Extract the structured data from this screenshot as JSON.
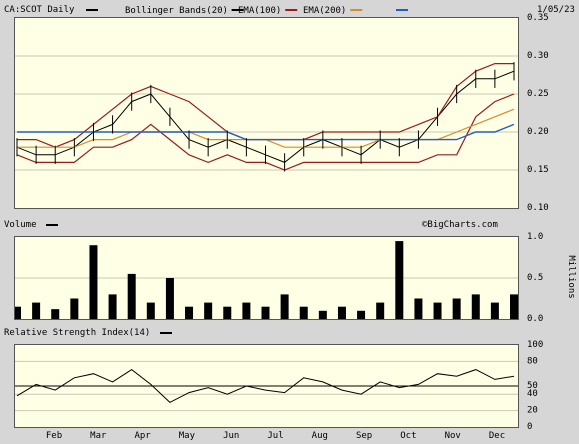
{
  "header": {
    "symbol": "CA:SCOT Daily",
    "legend": [
      {
        "name": "Bollinger Bands(20)",
        "color": "#000000"
      },
      {
        "name": "EMA(100)",
        "color": "#9a1c1c"
      },
      {
        "name": "EMA(200)",
        "color": "#d98b2b"
      }
    ],
    "date": "1/05/23",
    "ema200_line_color": "#1f5fc4"
  },
  "volume_header": "Volume",
  "rsi_header": "Relative Strength Index(14)",
  "watermark": "©BigCharts.com",
  "months": [
    "Feb",
    "Mar",
    "Apr",
    "May",
    "Jun",
    "Jul",
    "Aug",
    "Sep",
    "Oct",
    "Nov",
    "Dec"
  ],
  "volume_axis_title": "Millions",
  "chart_data": [
    {
      "type": "line",
      "panel": "price",
      "ylim": [
        0.1,
        0.35
      ],
      "yticks": [
        "0.35",
        "0.30",
        "0.25",
        "0.20",
        "0.15",
        "0.10"
      ],
      "x": [
        "2022-01-10",
        "2022-01-24",
        "2022-02-07",
        "2022-02-21",
        "2022-03-07",
        "2022-03-21",
        "2022-04-04",
        "2022-04-18",
        "2022-05-02",
        "2022-05-16",
        "2022-05-30",
        "2022-06-13",
        "2022-06-27",
        "2022-07-11",
        "2022-07-25",
        "2022-08-08",
        "2022-08-22",
        "2022-09-05",
        "2022-09-19",
        "2022-10-03",
        "2022-10-17",
        "2022-10-31",
        "2022-11-14",
        "2022-11-28",
        "2022-12-12",
        "2022-12-26",
        "2023-01-05"
      ],
      "series": [
        {
          "name": "Price",
          "values": [
            0.18,
            0.17,
            0.17,
            0.18,
            0.2,
            0.21,
            0.24,
            0.25,
            0.22,
            0.19,
            0.18,
            0.19,
            0.18,
            0.17,
            0.16,
            0.18,
            0.19,
            0.18,
            0.17,
            0.19,
            0.18,
            0.19,
            0.22,
            0.25,
            0.27,
            0.27,
            0.28
          ]
        },
        {
          "name": "Bollinger upper",
          "values": [
            0.19,
            0.19,
            0.18,
            0.19,
            0.21,
            0.23,
            0.25,
            0.26,
            0.25,
            0.24,
            0.22,
            0.2,
            0.19,
            0.19,
            0.19,
            0.19,
            0.2,
            0.2,
            0.2,
            0.2,
            0.2,
            0.21,
            0.22,
            0.26,
            0.28,
            0.29,
            0.29
          ]
        },
        {
          "name": "Bollinger lower",
          "values": [
            0.17,
            0.16,
            0.16,
            0.16,
            0.18,
            0.18,
            0.19,
            0.21,
            0.19,
            0.17,
            0.16,
            0.17,
            0.16,
            0.16,
            0.15,
            0.16,
            0.16,
            0.16,
            0.16,
            0.16,
            0.16,
            0.16,
            0.17,
            0.17,
            0.22,
            0.24,
            0.25
          ]
        },
        {
          "name": "EMA(100)",
          "values": [
            0.18,
            0.18,
            0.18,
            0.18,
            0.19,
            0.19,
            0.2,
            0.2,
            0.2,
            0.2,
            0.19,
            0.19,
            0.19,
            0.19,
            0.18,
            0.18,
            0.18,
            0.18,
            0.18,
            0.19,
            0.19,
            0.19,
            0.19,
            0.2,
            0.21,
            0.22,
            0.23
          ]
        },
        {
          "name": "EMA(200)",
          "values": [
            0.2,
            0.2,
            0.2,
            0.2,
            0.2,
            0.2,
            0.2,
            0.2,
            0.2,
            0.2,
            0.2,
            0.2,
            0.19,
            0.19,
            0.19,
            0.19,
            0.19,
            0.19,
            0.19,
            0.19,
            0.19,
            0.19,
            0.19,
            0.19,
            0.2,
            0.2,
            0.21
          ]
        }
      ]
    },
    {
      "type": "bar",
      "panel": "volume",
      "ylim": [
        0,
        1.0
      ],
      "yticks": [
        "1.0",
        "0.5",
        "0.0"
      ],
      "x": [
        "2022-01-10",
        "2022-01-24",
        "2022-02-07",
        "2022-02-21",
        "2022-03-07",
        "2022-03-21",
        "2022-04-04",
        "2022-04-18",
        "2022-05-02",
        "2022-05-16",
        "2022-05-30",
        "2022-06-13",
        "2022-06-27",
        "2022-07-11",
        "2022-07-25",
        "2022-08-08",
        "2022-08-22",
        "2022-09-05",
        "2022-09-19",
        "2022-10-03",
        "2022-10-17",
        "2022-10-31",
        "2022-11-14",
        "2022-11-28",
        "2022-12-12",
        "2022-12-26",
        "2023-01-05"
      ],
      "values": [
        0.15,
        0.2,
        0.12,
        0.25,
        0.9,
        0.3,
        0.55,
        0.2,
        0.5,
        0.15,
        0.2,
        0.15,
        0.2,
        0.15,
        0.3,
        0.15,
        0.1,
        0.15,
        0.1,
        0.2,
        0.95,
        0.25,
        0.2,
        0.25,
        0.3,
        0.2,
        0.3
      ]
    },
    {
      "type": "line",
      "panel": "rsi",
      "ylim": [
        0,
        100
      ],
      "yticks": [
        "100",
        "80",
        "50",
        "40",
        "20",
        "0"
      ],
      "reference": 50,
      "x": [
        "2022-01-10",
        "2022-01-24",
        "2022-02-07",
        "2022-02-21",
        "2022-03-07",
        "2022-03-21",
        "2022-04-04",
        "2022-04-18",
        "2022-05-02",
        "2022-05-16",
        "2022-05-30",
        "2022-06-13",
        "2022-06-27",
        "2022-07-11",
        "2022-07-25",
        "2022-08-08",
        "2022-08-22",
        "2022-09-05",
        "2022-09-19",
        "2022-10-03",
        "2022-10-17",
        "2022-10-31",
        "2022-11-14",
        "2022-11-28",
        "2022-12-12",
        "2022-12-26",
        "2023-01-05"
      ],
      "values": [
        38,
        52,
        45,
        60,
        65,
        55,
        70,
        52,
        30,
        42,
        48,
        40,
        50,
        45,
        42,
        60,
        55,
        45,
        40,
        55,
        48,
        52,
        65,
        62,
        70,
        58,
        62
      ]
    }
  ]
}
